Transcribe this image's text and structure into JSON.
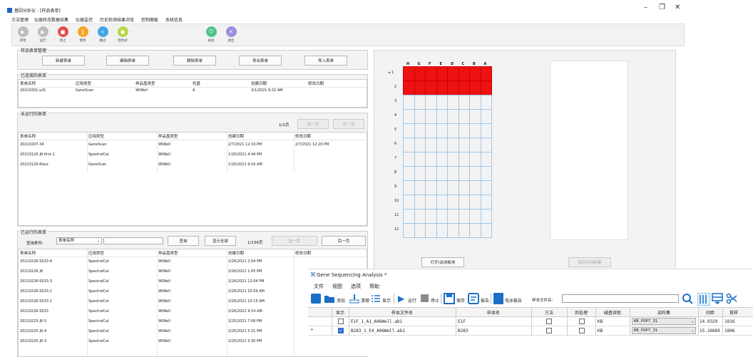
{
  "app": {
    "title": "基因分析仪 - [样品表单]"
  },
  "window_controls": {
    "minimize": "–",
    "restore": "❐",
    "close": "✕"
  },
  "menu": [
    "方法管理",
    "仪器状态数据采集",
    "仪器监控",
    "历史检测结果浏览",
    "控制面板",
    "系统信息"
  ],
  "toolbar": [
    {
      "label": "开始",
      "color": "#bdbdbd",
      "glyph": "▶"
    },
    {
      "label": "运行",
      "color": "#bdbdbd",
      "glyph": "▶"
    },
    {
      "label": "停止",
      "color": "#e94b4b",
      "glyph": "■"
    },
    {
      "label": "暂停",
      "color": "#f5a623",
      "glyph": "‖"
    },
    {
      "label": "跳过",
      "color": "#3fa7e8",
      "glyph": "»"
    },
    {
      "label": "暗色式",
      "color": "#b7d84a",
      "glyph": "●"
    },
    {
      "label": "关闭",
      "color": "#4fc38a",
      "glyph": "⏻"
    },
    {
      "label": "退出",
      "color": "#9a8fe0",
      "glyph": "✕"
    }
  ],
  "sample_mgmt": {
    "title": "样品表单管理",
    "buttons": [
      "新建表单",
      "编辑表单",
      "删除表单",
      "导出表单",
      "导入表单"
    ]
  },
  "linked": {
    "title": "已连接的表单",
    "columns": [
      "表单名称",
      "应用类型",
      "样品盘类型",
      "托盘",
      "创建日期",
      "修改日期"
    ],
    "rows": [
      [
        "20210301-y41",
        "GeneScan",
        "96Well",
        "A",
        "3/1/2021 9:32 AM",
        ""
      ]
    ]
  },
  "pending": {
    "title": "未运行的表单",
    "page": "1/1页",
    "prev": "前一页",
    "next": "后一页",
    "columns": [
      "表单名称",
      "应用类型",
      "样品盘类型",
      "创建日期",
      "修改日期"
    ],
    "rows": [
      [
        "20210207-34",
        "GeneScan",
        "96Well",
        "2/7/2021 12:19 PM",
        "2/7/2021 12:20 PM"
      ],
      [
        "20210120-J6-first-1",
        "SpectralCal",
        "96Well",
        "1/20/2021 4:44 PM",
        ""
      ],
      [
        "20210120-6dye",
        "GeneScan",
        "96Well",
        "1/20/2021 9:16 AM",
        ""
      ]
    ]
  },
  "done": {
    "title": "已运行的表单",
    "query_label": "查询条件:",
    "query_select": "表单名称",
    "query_button": "查询",
    "show_all": "显示全部",
    "page": "1/136页",
    "prev": "前一页",
    "next": "后一页",
    "columns": [
      "表单名称",
      "应用类型",
      "样品盘类型",
      "创建日期",
      "修改日期"
    ],
    "rows": [
      [
        "20210226-SS33-4",
        "SpectralCal",
        "96Well",
        "2/26/2021 2:54 PM",
        ""
      ],
      [
        "20210226-J6",
        "SpectralCal",
        "96Well",
        "2/26/2021 1:05 PM",
        ""
      ],
      [
        "20210226-SS33-3",
        "SpectralCal",
        "96Well",
        "2/26/2021 12:04 PM",
        ""
      ],
      [
        "20210226-SS33-2",
        "SpectralCal",
        "96Well",
        "2/26/2021 10:59 AM",
        ""
      ],
      [
        "20210226-SS33-1",
        "SpectralCal",
        "96Well",
        "2/26/2021 10:15 AM",
        ""
      ],
      [
        "20210226-SS33",
        "SpectralCal",
        "96Well",
        "2/26/2021 9:14 AM",
        ""
      ],
      [
        "20210225-J6-5",
        "SpectralCal",
        "96Well",
        "2/25/2021 7:06 PM",
        ""
      ],
      [
        "20210225-J6-4",
        "SpectralCal",
        "96Well",
        "2/25/2021 5:21 PM",
        ""
      ],
      [
        "20210225-J6-3",
        "SpectralCal",
        "96Well",
        "2/25/2021 5:30 PM",
        ""
      ]
    ]
  },
  "plate": {
    "columns": [
      "H",
      "G",
      "F",
      "E",
      "D",
      "C",
      "B",
      "A"
    ],
    "rows": [
      "1",
      "2",
      "3",
      "4",
      "5",
      "6",
      "7",
      "8",
      "9",
      "10",
      "11",
      "12"
    ],
    "selected_marker": "▸",
    "filled_rows": 2,
    "fill_color": "#ee1111",
    "open_button": "打开/关闭板块",
    "right_button": "保存检测结果"
  },
  "seq": {
    "title": "Gene Sequencing Analysis *",
    "menu": [
      "文件",
      "视图",
      "选项",
      "帮助"
    ],
    "tools": [
      "添加",
      "清理",
      "显示",
      "运行",
      "停止",
      "保存",
      "报告",
      "电泳报告"
    ],
    "filename_label": "样本文件名:",
    "columns": [
      "显示",
      "样本文件名",
      "样本名",
      "方法",
      "后处理",
      "碱基读取",
      "染料集",
      "间距",
      "首样"
    ],
    "rows": [
      {
        "marker": "",
        "show": false,
        "file": "E1F_1_A1_A06Well.ab1",
        "name": "E1F",
        "method": false,
        "post": false,
        "basecall": "KB",
        "dye": "KB_POP7_31",
        "spacing": "14.9329",
        "first": "1816"
      },
      {
        "marker": "▸",
        "show": true,
        "file": "B283_1_E4_A06Well.ab1",
        "name": "B283",
        "method": false,
        "post": false,
        "basecall": "KB",
        "dye": "KB_POP7_31",
        "spacing": "15.26689",
        "first": "1806"
      }
    ]
  }
}
